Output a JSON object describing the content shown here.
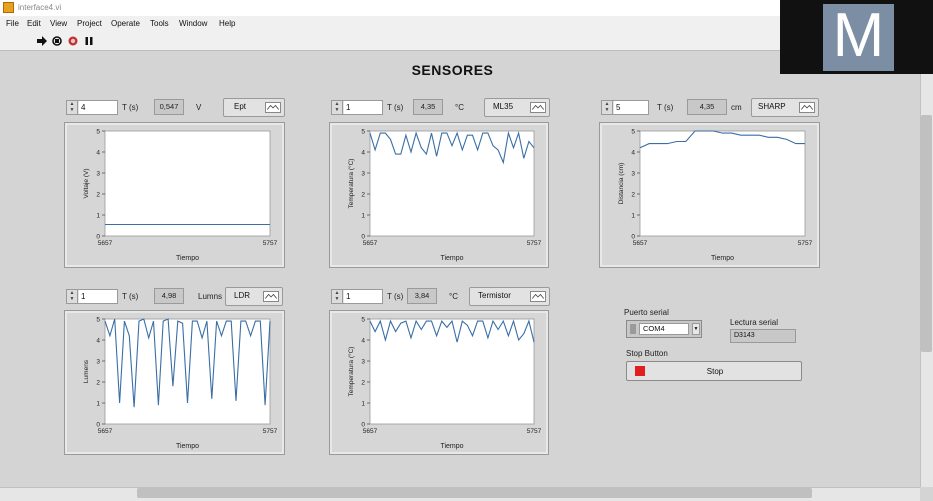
{
  "window": {
    "title": "interface4.vi"
  },
  "menu": [
    "File",
    "Edit",
    "View",
    "Project",
    "Operate",
    "Tools",
    "Window",
    "Help"
  ],
  "toolbar": {
    "icons": [
      "run-arrow-icon",
      "run-continuous-icon",
      "abort-icon",
      "pause-icon"
    ]
  },
  "page_title": "SENSORES",
  "colors": {
    "plot_line": "#3a6ea5",
    "stop_led": "#e02020",
    "panel_bg": "#d4d4d4"
  },
  "sensors": [
    {
      "id": "volt",
      "t_value": "4",
      "t_label": "T (s)",
      "reading": "0,547",
      "unit": "V",
      "button": "Ept",
      "ylabel": "Voltaje (V)",
      "xlabel": "Tiempo",
      "x_min": "5657",
      "x_max": "5757",
      "y_ticks": [
        "5",
        "4",
        "3",
        "2",
        "1",
        "0"
      ]
    },
    {
      "id": "lm35",
      "t_value": "1",
      "t_label": "T (s)",
      "reading": "4,35",
      "unit": "°C",
      "button": "ML35",
      "ylabel": "Temperatura (°C)",
      "xlabel": "Tiempo",
      "x_min": "5657",
      "x_max": "5757",
      "y_ticks": [
        "5",
        "4",
        "3",
        "2",
        "1",
        "0"
      ]
    },
    {
      "id": "sharp",
      "t_value": "5",
      "t_label": "T (s)",
      "reading": "4,35",
      "unit": "cm",
      "button": "SHARP",
      "ylabel": "Distancia (cm)",
      "xlabel": "Tiempo",
      "x_min": "5657",
      "x_max": "5757",
      "y_ticks": [
        "5",
        "4",
        "3",
        "2",
        "1",
        "0"
      ]
    },
    {
      "id": "ldr",
      "t_value": "1",
      "t_label": "T (s)",
      "reading": "4,98",
      "unit": "Lumns",
      "button": "LDR",
      "ylabel": "Lumens",
      "xlabel": "Tiempo",
      "x_min": "5657",
      "x_max": "5757",
      "y_ticks": [
        "5",
        "4",
        "3",
        "2",
        "1",
        "0"
      ]
    },
    {
      "id": "term",
      "t_value": "1",
      "t_label": "T (s)",
      "reading": "3,84",
      "unit": "°C",
      "button": "Termistor",
      "ylabel": "Temperatura (°C)",
      "xlabel": "Tiempo",
      "x_min": "5657",
      "x_max": "5757",
      "y_ticks": [
        "5",
        "4",
        "3",
        "2",
        "1",
        "0"
      ]
    }
  ],
  "chart_data": [
    {
      "type": "line",
      "series": [
        {
          "values": [
            0.55,
            0.55,
            0.55,
            0.55,
            0.55,
            0.55,
            0.55,
            0.55,
            0.55,
            0.55,
            0.55
          ]
        }
      ],
      "ylim": [
        0,
        5
      ],
      "xlabel": "Tiempo",
      "ylabel": "Voltaje (V)",
      "x_ticks": [
        "5657",
        "5757"
      ]
    },
    {
      "type": "line",
      "series": [
        {
          "values": [
            4.9,
            4.1,
            4.9,
            4.9,
            4.6,
            3.9,
            3.9,
            4.8,
            4.0,
            4.9,
            4.2,
            3.9,
            4.9,
            3.8,
            4.9,
            4.9,
            4.3,
            4.9,
            4.1,
            4.8,
            4.8,
            4.1,
            4.9,
            4.9,
            4.3,
            4.1,
            3.5,
            4.9,
            4.2,
            4.9,
            3.7,
            4.5,
            4.2
          ]
        }
      ],
      "ylim": [
        0,
        5
      ],
      "xlabel": "Tiempo",
      "ylabel": "Temperatura (°C)",
      "x_ticks": [
        "5657",
        "5757"
      ]
    },
    {
      "type": "line",
      "series": [
        {
          "values": [
            4.2,
            4.4,
            4.4,
            4.4,
            4.5,
            4.5,
            5.0,
            5.0,
            5.0,
            4.9,
            4.9,
            4.8,
            4.8,
            4.8,
            4.7,
            4.7,
            4.6,
            4.4,
            4.4
          ]
        }
      ],
      "ylim": [
        0,
        5
      ],
      "xlabel": "Tiempo",
      "ylabel": "Distancia (cm)",
      "x_ticks": [
        "5657",
        "5757"
      ]
    },
    {
      "type": "line",
      "series": [
        {
          "values": [
            4.9,
            4.2,
            5.0,
            1.0,
            4.9,
            4.2,
            0.8,
            4.9,
            5.0,
            4.1,
            4.9,
            0.9,
            4.9,
            5.0,
            1.8,
            4.9,
            4.8,
            1.0,
            4.9,
            4.9,
            4.1,
            4.9,
            1.2,
            4.9,
            4.2,
            4.9,
            4.9,
            1.1,
            4.9,
            4.9,
            4.2,
            4.9,
            4.9,
            0.9,
            4.9
          ]
        }
      ],
      "ylim": [
        0,
        5
      ],
      "xlabel": "Tiempo",
      "ylabel": "Lumens",
      "x_ticks": [
        "5657",
        "5757"
      ]
    },
    {
      "type": "line",
      "series": [
        {
          "values": [
            4.9,
            4.4,
            4.9,
            4.0,
            4.9,
            4.4,
            4.8,
            4.9,
            4.1,
            4.9,
            4.5,
            4.9,
            4.9,
            4.2,
            4.9,
            4.6,
            4.9,
            3.9,
            4.9,
            4.7,
            4.2,
            4.9,
            4.9,
            4.1,
            4.9,
            4.5,
            4.9,
            4.2,
            4.9,
            4.0,
            4.3,
            4.9,
            3.9
          ]
        }
      ],
      "ylim": [
        0,
        5
      ],
      "xlabel": "Tiempo",
      "ylabel": "Temperatura (°C)",
      "x_ticks": [
        "5657",
        "5757"
      ]
    }
  ],
  "serial": {
    "port_label": "Puerto serial",
    "port_value": "COM4",
    "read_label": "Lectura serial",
    "read_value": "D3143",
    "stop_caption": "Stop Button",
    "stop_label": "Stop"
  },
  "watermark": {
    "letter": "M"
  }
}
